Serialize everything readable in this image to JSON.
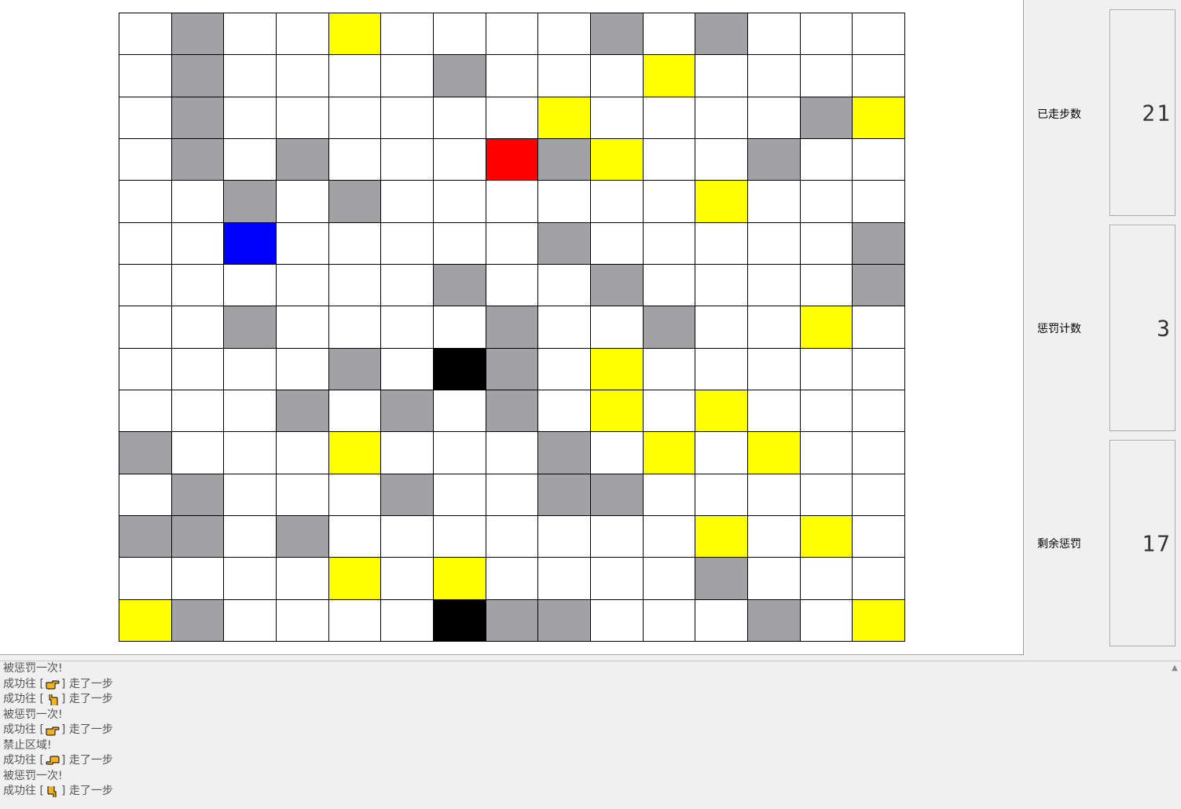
{
  "colors": {
    "empty": "#ffffff",
    "wall": "#a2a1a6",
    "penalty": "#ffff00",
    "player": "#0000ff",
    "goal": "#ff0000",
    "forbidden": "#000000"
  },
  "grid": [
    [
      "E",
      "W",
      "E",
      "E",
      "P",
      "E",
      "E",
      "E",
      "E",
      "W",
      "E",
      "W",
      "E",
      "E",
      "E"
    ],
    [
      "E",
      "W",
      "E",
      "E",
      "E",
      "E",
      "W",
      "E",
      "E",
      "E",
      "P",
      "E",
      "E",
      "E",
      "E"
    ],
    [
      "E",
      "W",
      "E",
      "E",
      "E",
      "E",
      "E",
      "E",
      "P",
      "E",
      "E",
      "E",
      "E",
      "W",
      "P"
    ],
    [
      "E",
      "W",
      "E",
      "W",
      "E",
      "E",
      "E",
      "G",
      "W",
      "P",
      "E",
      "E",
      "W",
      "E",
      "E"
    ],
    [
      "E",
      "E",
      "W",
      "E",
      "W",
      "E",
      "E",
      "E",
      "E",
      "E",
      "E",
      "P",
      "E",
      "E",
      "E"
    ],
    [
      "E",
      "E",
      "B",
      "E",
      "E",
      "E",
      "E",
      "E",
      "W",
      "E",
      "E",
      "E",
      "E",
      "E",
      "W"
    ],
    [
      "E",
      "E",
      "E",
      "E",
      "E",
      "E",
      "W",
      "E",
      "E",
      "W",
      "E",
      "E",
      "E",
      "E",
      "W"
    ],
    [
      "E",
      "E",
      "W",
      "E",
      "E",
      "E",
      "E",
      "W",
      "E",
      "E",
      "W",
      "E",
      "E",
      "P",
      "E"
    ],
    [
      "E",
      "E",
      "E",
      "E",
      "W",
      "E",
      "K",
      "W",
      "E",
      "P",
      "E",
      "E",
      "E",
      "E",
      "E"
    ],
    [
      "E",
      "E",
      "E",
      "W",
      "E",
      "W",
      "E",
      "W",
      "E",
      "P",
      "E",
      "P",
      "E",
      "E",
      "E"
    ],
    [
      "W",
      "E",
      "E",
      "E",
      "P",
      "E",
      "E",
      "E",
      "W",
      "E",
      "P",
      "E",
      "P",
      "E",
      "E"
    ],
    [
      "E",
      "W",
      "E",
      "E",
      "E",
      "W",
      "E",
      "E",
      "W",
      "W",
      "E",
      "E",
      "E",
      "E",
      "E"
    ],
    [
      "W",
      "W",
      "E",
      "W",
      "E",
      "E",
      "E",
      "E",
      "E",
      "E",
      "E",
      "P",
      "E",
      "P",
      "E"
    ],
    [
      "E",
      "E",
      "E",
      "E",
      "P",
      "E",
      "P",
      "E",
      "E",
      "E",
      "E",
      "W",
      "E",
      "E",
      "E"
    ],
    [
      "P",
      "W",
      "E",
      "E",
      "E",
      "E",
      "K",
      "W",
      "W",
      "E",
      "E",
      "E",
      "W",
      "E",
      "P"
    ]
  ],
  "stats": {
    "steps_label": "已走步数",
    "steps_value": "21",
    "penalty_label": "惩罚计数",
    "penalty_value": "3",
    "remaining_label": "剩余惩罚",
    "remaining_value": "17"
  },
  "log": [
    {
      "text": "被惩罚一次!"
    },
    {
      "prefix": "成功往 [",
      "hand": "hand-right-icon",
      "suffix": "] 走了一步"
    },
    {
      "prefix": "成功往 [",
      "hand": "hand-up-icon",
      "suffix": "] 走了一步"
    },
    {
      "text": "被惩罚一次!"
    },
    {
      "prefix": "成功往 [",
      "hand": "hand-right-icon",
      "suffix": "] 走了一步"
    },
    {
      "text": "禁止区域!"
    },
    {
      "prefix": "成功往 [",
      "hand": "hand-left-icon",
      "suffix": "] 走了一步"
    },
    {
      "text": "被惩罚一次!"
    },
    {
      "prefix": "成功往 [",
      "hand": "hand-down-icon",
      "suffix": "] 走了一步"
    }
  ]
}
